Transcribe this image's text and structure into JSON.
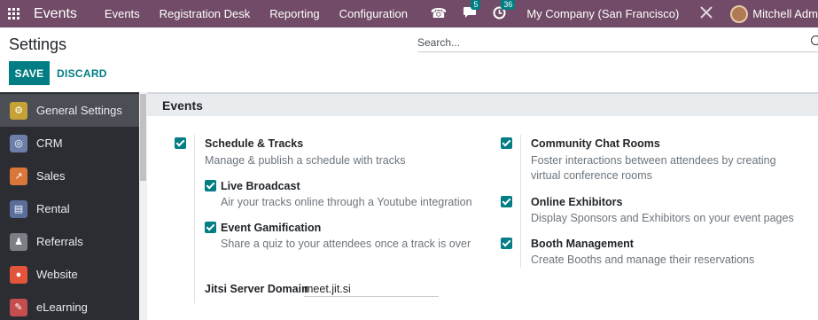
{
  "navbar": {
    "app_name": "Events",
    "menu": [
      "Events",
      "Registration Desk",
      "Reporting",
      "Configuration"
    ],
    "messages_count": "5",
    "activities_count": "36",
    "company": "My Company (San Francisco)",
    "user": "Mitchell Adm",
    "colors": {
      "bar": "#714B67",
      "badge": "#017e84"
    }
  },
  "control_panel": {
    "title": "Settings",
    "search_placeholder": "Search...",
    "save_label": "SAVE",
    "discard_label": "DISCARD"
  },
  "sidebar": {
    "items": [
      {
        "label": "General Settings",
        "icon": "gear-icon",
        "color": "#c6a136"
      },
      {
        "label": "CRM",
        "icon": "handshake-icon",
        "color": "#6b7fa8"
      },
      {
        "label": "Sales",
        "icon": "chart-icon",
        "color": "#d9773a"
      },
      {
        "label": "Rental",
        "icon": "rental-icon",
        "color": "#5a6e9b"
      },
      {
        "label": "Referrals",
        "icon": "referrals-icon",
        "color": "#7c7f86"
      },
      {
        "label": "Website",
        "icon": "website-icon",
        "color": "#e3543b"
      },
      {
        "label": "eLearning",
        "icon": "elearning-icon",
        "color": "#c54d4d"
      }
    ]
  },
  "section": {
    "title": "Events",
    "left_options": [
      {
        "title": "Schedule & Tracks",
        "desc": "Manage & publish a schedule with tracks",
        "checked": true
      },
      {
        "title": "Live Broadcast",
        "desc": "Air your tracks online through a Youtube integration",
        "checked": true
      },
      {
        "title": "Event Gamification",
        "desc": "Share a quiz to your attendees once a track is over",
        "checked": true
      }
    ],
    "right_options": [
      {
        "title": "Community Chat Rooms",
        "desc": "Foster interactions between attendees by creating virtual conference rooms",
        "checked": true
      },
      {
        "title": "Online Exhibitors",
        "desc": "Display Sponsors and Exhibitors on your event pages",
        "checked": true
      },
      {
        "title": "Booth Management",
        "desc": "Create Booths and manage their reservations",
        "checked": true
      }
    ],
    "jitsi_label": "Jitsi Server Domain",
    "jitsi_value": "meet.jit.si"
  }
}
